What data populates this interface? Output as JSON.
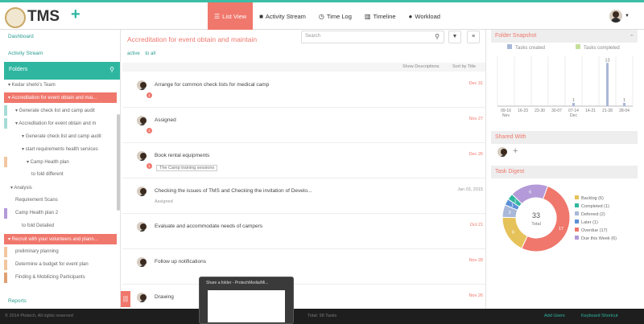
{
  "app": {
    "name": "TMS",
    "add": "+"
  },
  "nav": [
    {
      "label": "List View",
      "icon": "list-icon"
    },
    {
      "label": "Activity Stream",
      "icon": "comment-icon"
    },
    {
      "label": "Time Log",
      "icon": "clock-icon"
    },
    {
      "label": "Timeline",
      "icon": "bars-icon"
    },
    {
      "label": "Workload",
      "icon": "user-icon"
    }
  ],
  "sidebar": {
    "dashboard": "Dashboard",
    "activity": "Activity Stream",
    "folders": "Folders",
    "tree": [
      {
        "label": "▾ Kedar sherki's Team"
      },
      {
        "label": "▾ Accreditation for event obtain and mai...",
        "color": "#f0776c"
      },
      {
        "label": "▾ Generate check list and camp audit",
        "color": "#a7dcd6"
      },
      {
        "label": "▾ Accreditation for event obtain and m",
        "color": "#a7dcd6"
      },
      {
        "label": "▾ Generate check list and camp audit",
        "color": ""
      },
      {
        "label": "▾ start requirements health services",
        "color": ""
      },
      {
        "label": "▾ Camp Health plan",
        "color": "#f2c6a0"
      },
      {
        "label": "to fold different",
        "color": ""
      },
      {
        "label": "▾ Analysis",
        "color": ""
      },
      {
        "label": "Requirement Scans",
        "color": ""
      },
      {
        "label": "Camp Health plan 2",
        "color": "#b49ad8"
      },
      {
        "label": "to fold Detailed",
        "color": ""
      },
      {
        "label": "▾ Recruit with your volunteers and plann...",
        "color": "#f0776c"
      },
      {
        "label": "preliminary planning",
        "color": "#f2c6a0"
      },
      {
        "label": "Determine a budget for event plan",
        "color": "#f2c6a0"
      },
      {
        "label": "Finding & Mobilizing Participants",
        "color": "#e0a072"
      }
    ],
    "reports": "Reports"
  },
  "main": {
    "title": "Accreditation for event obtain and maintain",
    "search_placeholder": "Search",
    "filter_active": "active",
    "filter_to": "to all",
    "show_desc": "Show Descriptions",
    "sort_by": "Sort by Title",
    "tasks": [
      {
        "title": "Arrange for common check lists for medical camp",
        "date": "Dec 31",
        "sub": "",
        "badge": "1"
      },
      {
        "title": "Assigned",
        "date": "Nov 27",
        "sub": "",
        "badge": "1"
      },
      {
        "title": "Book rental equipments",
        "date": "Dec 26",
        "sub": "",
        "tag": "The Camp training sessions",
        "badge": "1"
      },
      {
        "title": "Checking the issues of TMS and Checking the invitation of Develo...",
        "date": "Jan 03, 2015",
        "sub": "Assigned",
        "badge": ""
      },
      {
        "title": "Evaluate and accommodate needs of campers",
        "date": "Oct 21",
        "sub": "",
        "badge": ""
      },
      {
        "title": "Follow up notifications",
        "date": "Nov 28",
        "sub": "",
        "badge": ""
      },
      {
        "title": "Drawing",
        "date": "Nov 26",
        "sub": "",
        "badge": ""
      }
    ]
  },
  "right": {
    "snapshot": {
      "title": "Folder Snapshot",
      "legend_created": "Tasks created",
      "legend_completed": "Tasks completed"
    },
    "shared": {
      "title": "Shared With"
    },
    "digest": {
      "title": "Task Digest",
      "center_value": "33",
      "center_label": "Total"
    }
  },
  "chart_data": [
    {
      "type": "bar",
      "title": "Folder Snapshot",
      "categories": [
        "09-16",
        "16-23",
        "23-30",
        "30-07",
        "07-14",
        "14-21",
        "21-28",
        "28-04"
      ],
      "axis_groups": [
        "Nov",
        "",
        "",
        "",
        "Dec",
        "",
        "",
        ""
      ],
      "series": [
        {
          "name": "Tasks created",
          "values": [
            0,
            0,
            0,
            0,
            1,
            0,
            13,
            1
          ],
          "color": "#a9b8d8"
        },
        {
          "name": "Tasks completed",
          "values": [
            0,
            0,
            0,
            0,
            0,
            0,
            0,
            0
          ],
          "color": "#c6e09b"
        }
      ],
      "data_labels": [
        "",
        "",
        "",
        "",
        "1",
        "",
        "13",
        "1"
      ],
      "ylim": [
        0,
        15
      ]
    },
    {
      "type": "pie",
      "title": "Task Digest",
      "total": 33,
      "labels": [
        "Backlog",
        "Completed",
        "Deferred",
        "Later",
        "Overdue",
        "Due this Week"
      ],
      "values": [
        6,
        1,
        2,
        1,
        17,
        6
      ],
      "colors": [
        "#e6c25a",
        "#2fb6a0",
        "#a9b8d8",
        "#5b8fd6",
        "#f0776c",
        "#b49ad8"
      ],
      "legend": [
        "Backlog (6)",
        "Completed (1)",
        "Deferred (2)",
        "Later (1)",
        "Overdue (17)",
        "Due this Week (6)"
      ]
    }
  ],
  "footer": {
    "copyright": "© 2014 Ptotech, All rights reserved",
    "total": "Total: 98 Tasks",
    "add_users": "Add Users",
    "shortcuts": "Keyboard Shortcut"
  },
  "thumbnail": {
    "title": "Share a folder - ProtechMedia/Mi..."
  }
}
